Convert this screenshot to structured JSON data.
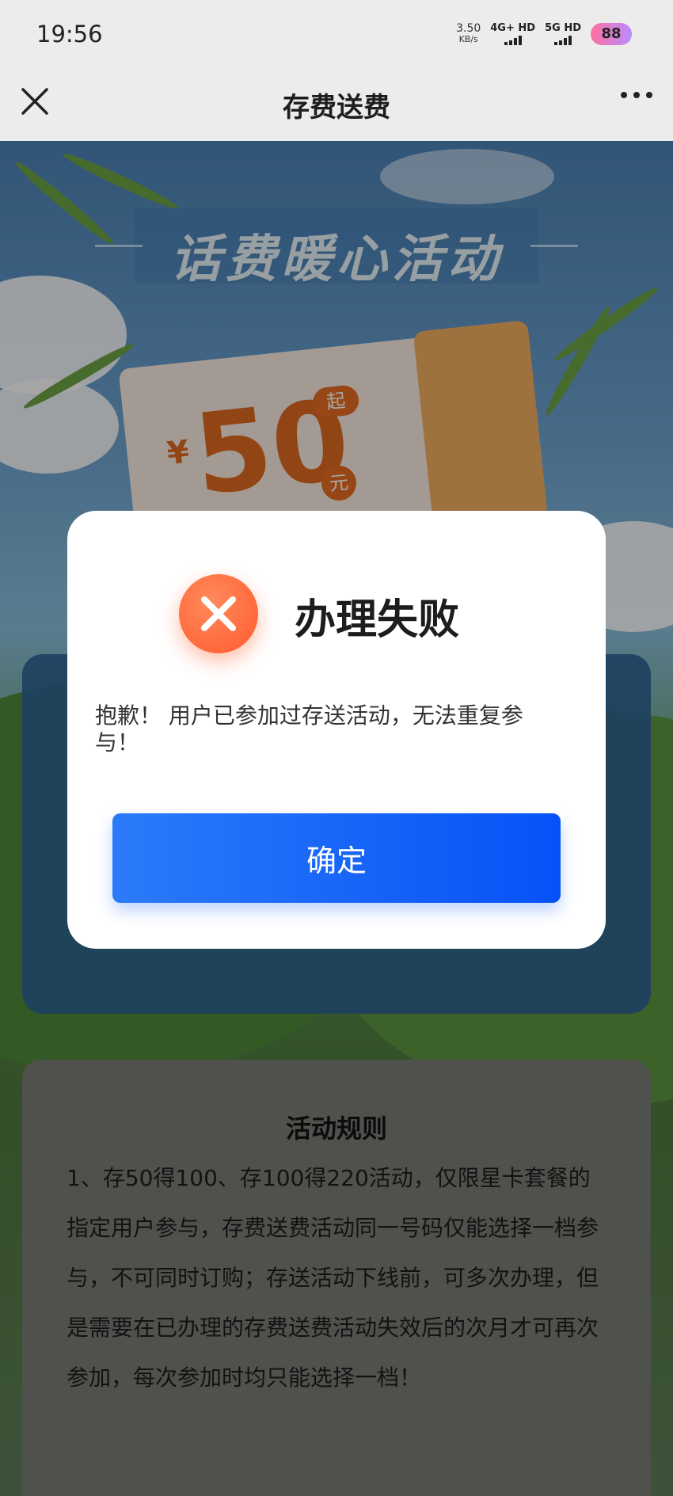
{
  "status_bar": {
    "time": "19:56",
    "net_speed_value": "3.50",
    "net_speed_unit": "KB/s",
    "sim1": "4G+ HD",
    "sim2": "5G HD",
    "battery": "88"
  },
  "nav": {
    "title": "存费送费"
  },
  "banner": {
    "title": "话费暖心活动"
  },
  "coupon": {
    "currency": "¥",
    "amount": "50",
    "qi": "起",
    "unit": "元"
  },
  "modal": {
    "title": "办理失败",
    "message": "抱歉！ 用户已参加过存送活动，无法重复参与！",
    "confirm_label": "确定"
  },
  "rules": {
    "title": "活动规则",
    "text": "1、存50得100、存100得220活动，仅限星卡套餐的指定用户参与，存费送费活动同一号码仅能选择一档参与，不可同时订购；存送活动下线前，可多次办理，但是需要在已办理的存费送费活动失效后的次月才可再次参加，每次参加时均只能选择一档！"
  },
  "colors": {
    "confirm_button": "#1563f8",
    "fail_icon": "#ff6a3d",
    "coupon_accent": "#e06a1f"
  }
}
